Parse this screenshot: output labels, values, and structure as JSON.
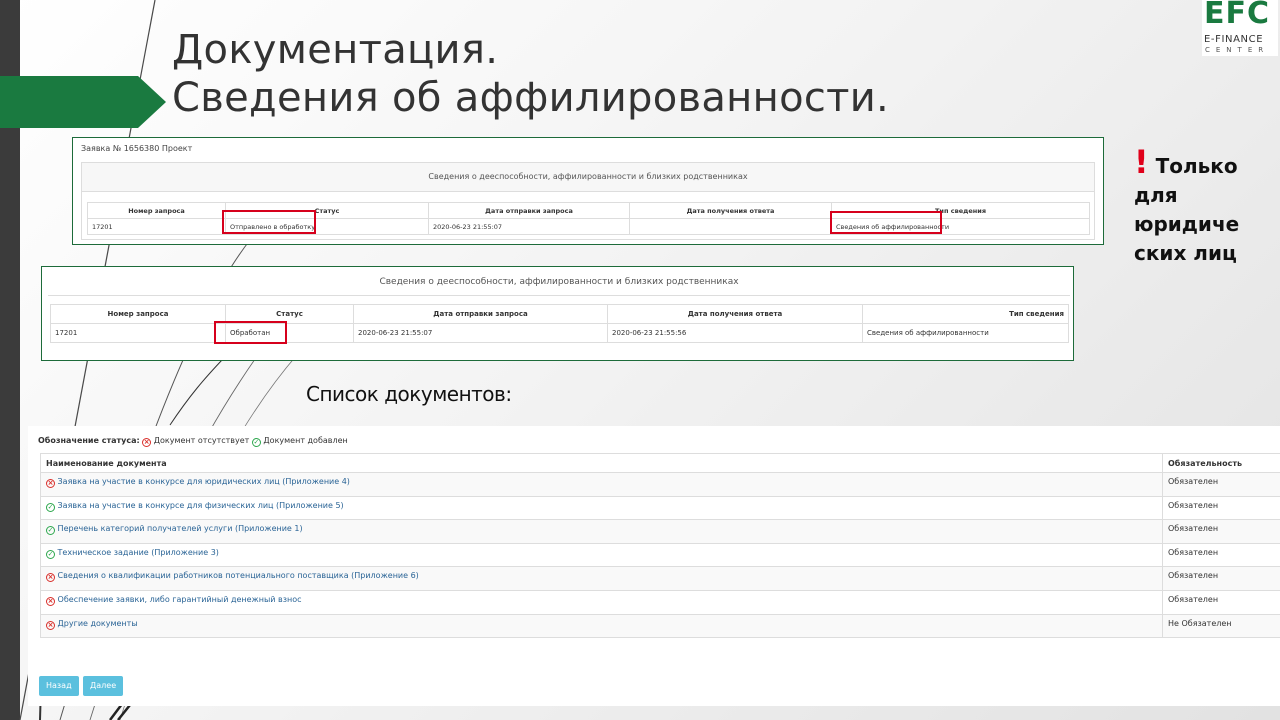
{
  "slide": {
    "title_line1": "Документация.",
    "title_line2": "Сведения об аффилированности."
  },
  "logo": {
    "main": "EFC",
    "sub1": "E-FINANCE",
    "sub2": "CENTER"
  },
  "note": {
    "excl": "!",
    "line1": "Только",
    "line2": "для",
    "line3": "юридиче",
    "line4": "ских лиц"
  },
  "panel1": {
    "app_title": "Заявка № 1656380 Проект",
    "section_title": "Сведения о дееспособности, аффилированности и близких родственниках",
    "columns": [
      "Номер запроса",
      "Статус",
      "Дата отправки запроса",
      "Дата получения ответа",
      "Тип сведения"
    ],
    "row": [
      "17201",
      "Отправлено в обработку",
      "2020-06-23 21:55:07",
      "",
      "Сведения об аффилированности"
    ]
  },
  "panel2": {
    "section_title": "Сведения о дееспособности, аффилированности и близких родственниках",
    "columns": [
      "Номер запроса",
      "Статус",
      "Дата отправки запроса",
      "Дата получения ответа",
      "Тип сведения"
    ],
    "row": [
      "17201",
      "Обработан",
      "2020-06-23 21:55:07",
      "2020-06-23 21:55:56",
      "Сведения об аффилированности"
    ]
  },
  "docs_caption": "Список документов:",
  "doclist": {
    "legend_label": "Обозначение статуса:",
    "legend_missing": "Документ отсутствует",
    "legend_added": "Документ добавлен",
    "col_name": "Наименование документа",
    "col_required": "Обязательность",
    "rows": [
      {
        "status": "missing",
        "name": "Заявка на участие в конкурсе для юридических лиц (Приложение 4)",
        "required": "Обязателен"
      },
      {
        "status": "added",
        "name": "Заявка на участие в конкурсе для физических лиц (Приложение 5)",
        "required": "Обязателен"
      },
      {
        "status": "added",
        "name": "Перечень категорий получателей услуги (Приложение 1)",
        "required": "Обязателен"
      },
      {
        "status": "added",
        "name": "Техническое задание (Приложение 3)",
        "required": "Обязателен"
      },
      {
        "status": "missing",
        "name": "Сведения о квалификации работников потенциального поставщика (Приложение 6)",
        "required": "Обязателен"
      },
      {
        "status": "missing",
        "name": "Обеспечение заявки, либо гарантийный денежный взнос",
        "required": "Обязателен"
      },
      {
        "status": "missing",
        "name": "Другие документы",
        "required": "Не Обязателен"
      }
    ],
    "back_label": "Назад",
    "next_label": "Далее"
  },
  "colors": {
    "accent_green": "#1a7a40",
    "highlight_red": "#d6001c",
    "status_ok": "#2fa84f",
    "status_missing": "#d9302c",
    "link": "#2a6496",
    "button": "#5bc0de"
  },
  "icons": {
    "missing": "x-circle-icon",
    "added": "check-circle-icon"
  }
}
